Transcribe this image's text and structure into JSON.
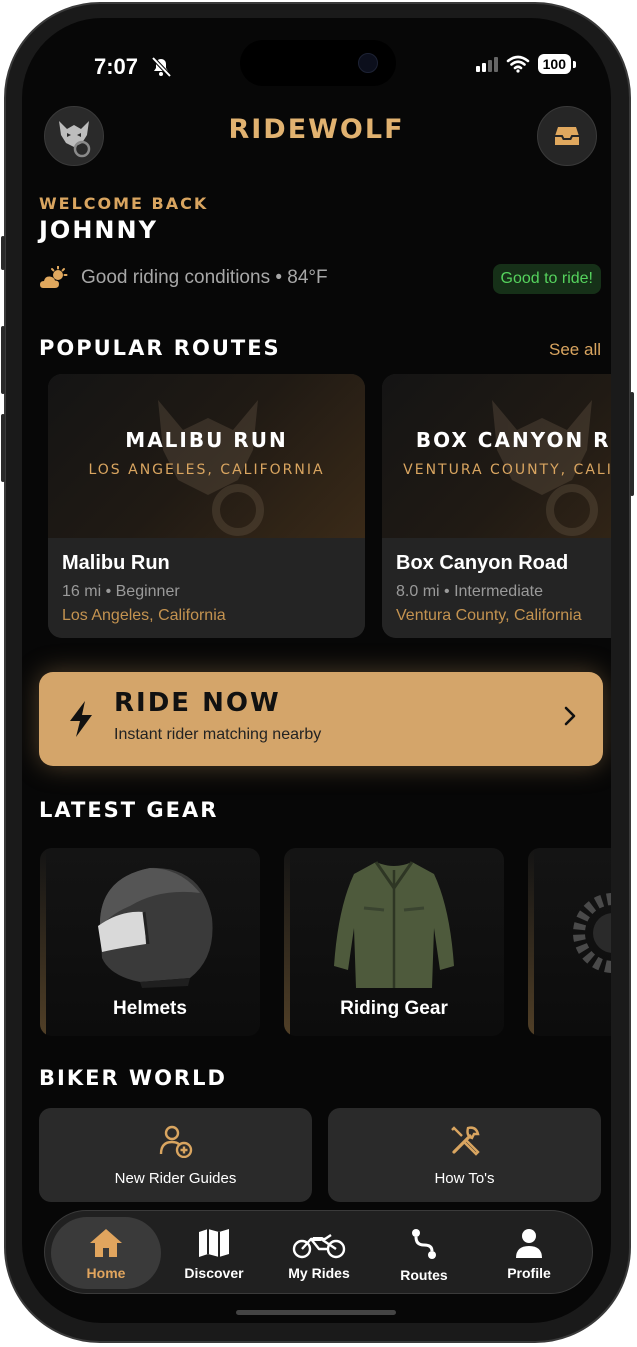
{
  "status_bar": {
    "time": "7:07",
    "battery": "100"
  },
  "header": {
    "logo": "RIDEWOLF"
  },
  "greeting": {
    "welcome": "WELCOME BACK",
    "name": "JOHNNY"
  },
  "weather": {
    "text": "Good riding conditions • 84°F",
    "badge": "Good to ride!"
  },
  "popular_routes": {
    "title": "POPULAR ROUTES",
    "see_all": "See all",
    "routes": [
      {
        "hero_title": "MALIBU RUN",
        "hero_sub": "LOS ANGELES, CALIFORNIA",
        "name": "Malibu Run",
        "meta": "16 mi  •  Beginner",
        "location": "Los Angeles, California"
      },
      {
        "hero_title": "BOX CANYON ROAD",
        "hero_sub": "VENTURA COUNTY, CALIFORNIA",
        "name": "Box Canyon Road",
        "meta": "8.0 mi  •  Intermediate",
        "location": "Ventura County, California"
      }
    ]
  },
  "ride_now": {
    "title": "RIDE NOW",
    "subtitle": "Instant rider matching nearby"
  },
  "latest_gear": {
    "title": "LATEST GEAR",
    "items": [
      {
        "label": "Helmets"
      },
      {
        "label": "Riding Gear"
      }
    ]
  },
  "biker_world": {
    "title": "BIKER WORLD",
    "cards": [
      {
        "label": "New Rider Guides"
      },
      {
        "label": "How To's"
      }
    ]
  },
  "tabbar": {
    "tabs": [
      {
        "label": "Home",
        "icon": "home-icon",
        "active": true
      },
      {
        "label": "Discover",
        "icon": "map-icon"
      },
      {
        "label": "My Rides",
        "icon": "motorcycle-icon"
      },
      {
        "label": "Routes",
        "icon": "route-icon"
      },
      {
        "label": "Profile",
        "icon": "person-icon"
      }
    ]
  },
  "colors": {
    "accent": "#d9a560",
    "background": "#070707",
    "badge_green": "#55d25d"
  }
}
